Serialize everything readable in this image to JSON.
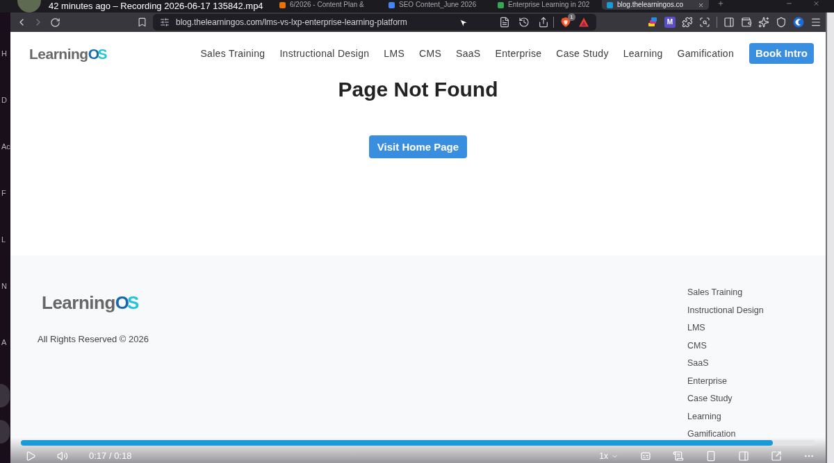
{
  "recording_title": "42 minutes ago – Recording 2026-06-17 135842.mp4",
  "browser": {
    "tabs": [
      {
        "title": "6/2026 - Content Plan &",
        "selected": false,
        "color": "#e8710a"
      },
      {
        "title": "SEO Content_June 2026",
        "selected": false,
        "color": "#4285f4"
      },
      {
        "title": "Enterprise Learning in 202",
        "selected": false,
        "color": "#34a853"
      },
      {
        "title": "blog.thelearningos.co",
        "selected": true,
        "color": "#1a9ad6"
      }
    ],
    "toolbar": {
      "forward_disabled": true,
      "address": "blog.thelearningos.com/lms-vs-lxp-enterprise-learning-platform",
      "shields_badge": "1",
      "extension_letter": "M"
    }
  },
  "desktop_edge": {
    "letters": [
      "H",
      "D",
      "Ac",
      "F",
      "L",
      "N",
      "A"
    ]
  },
  "site": {
    "logo": {
      "text": "Learning",
      "accent": "OS"
    },
    "nav": [
      "Sales Training",
      "Instructional Design",
      "LMS",
      "CMS",
      "SaaS",
      "Enterprise",
      "Case Study",
      "Learning",
      "Gamification"
    ],
    "cta": "Book Intro",
    "heading": "Page Not Found",
    "home_button": "Visit Home Page",
    "footer": {
      "logo": {
        "text": "Learning",
        "accent": "OS"
      },
      "copyright": "All Rights Reserved © 2026",
      "links": [
        "Sales Training",
        "Instructional Design",
        "LMS",
        "CMS",
        "SaaS",
        "Enterprise",
        "Case Study",
        "Learning",
        "Gamification"
      ]
    }
  },
  "player": {
    "progress": {
      "level": 0.947
    },
    "time": "0:17 / 0:18",
    "speed": "1x"
  }
}
